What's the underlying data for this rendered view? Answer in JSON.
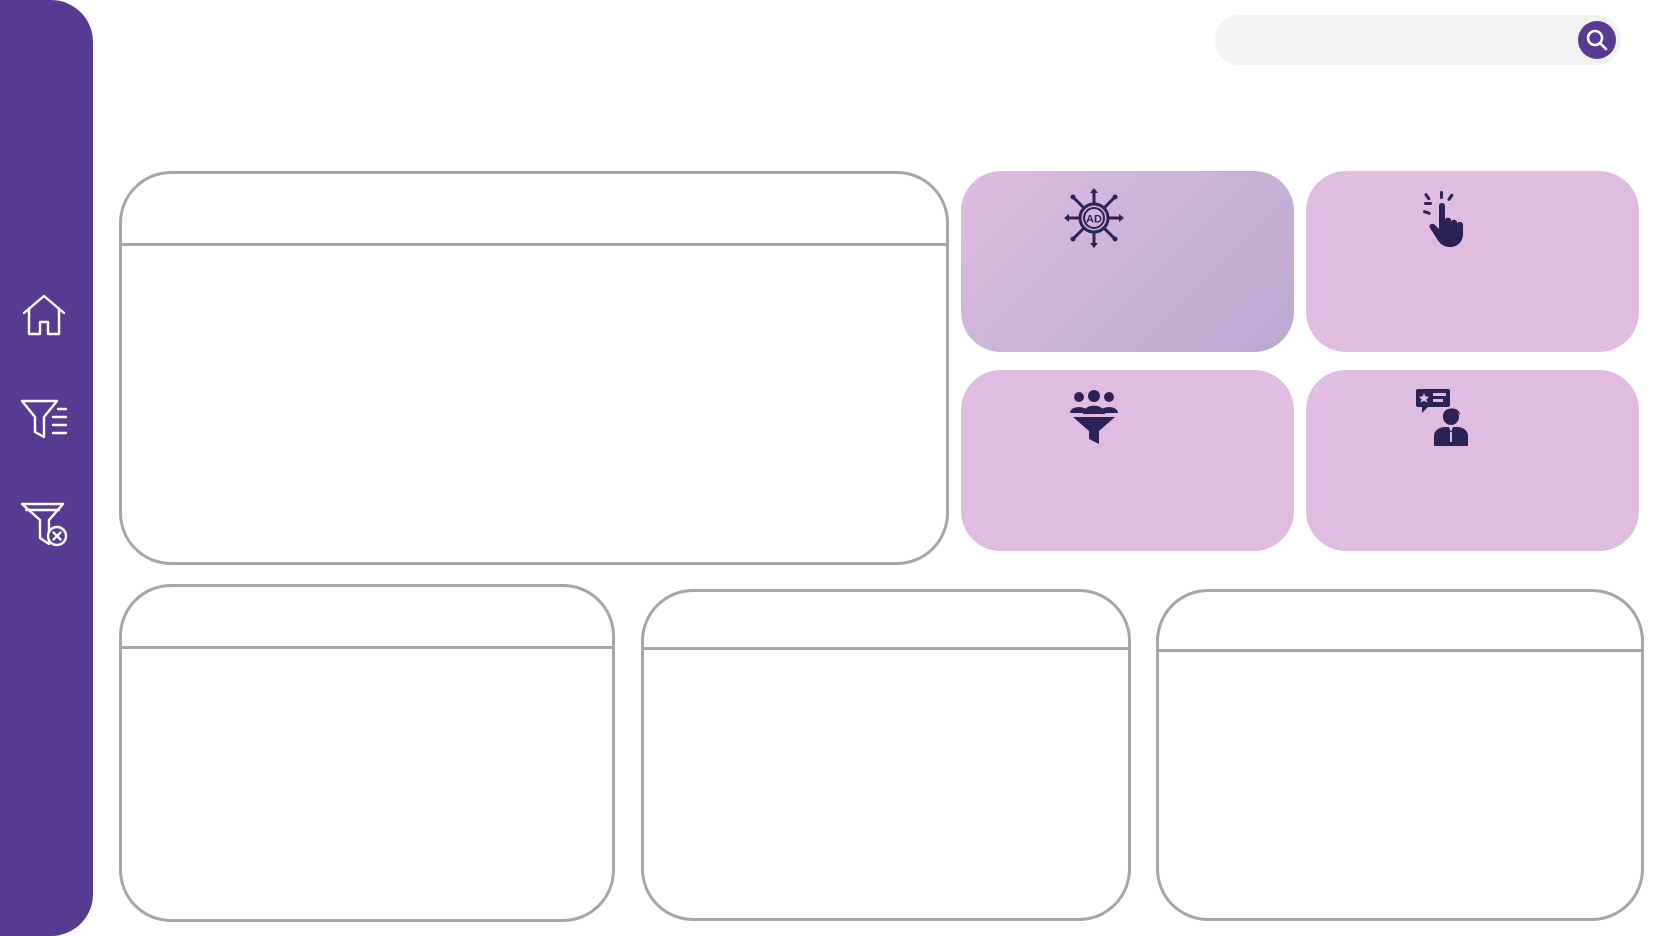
{
  "colors": {
    "sidebar": "#573b92",
    "tile": "#e0bce0",
    "tile_active_end": "#bca8d2",
    "icon": "#2b2357",
    "panel_border": "#a6a6a6",
    "search_bg": "#f2f2f2"
  },
  "sidebar": {
    "items": [
      {
        "icon": "home-icon"
      },
      {
        "icon": "filter-list-icon"
      },
      {
        "icon": "clear-filter-icon"
      }
    ]
  },
  "search": {
    "value": "",
    "placeholder": "",
    "button_icon": "search-icon"
  },
  "panels": {
    "main": {
      "title": ""
    },
    "bottom_left": {
      "title": ""
    },
    "bottom_middle": {
      "title": ""
    },
    "bottom_right": {
      "title": ""
    }
  },
  "tiles": [
    {
      "icon": "ad-broadcast-icon",
      "label": "",
      "value": "",
      "active": true
    },
    {
      "icon": "click-hand-icon",
      "label": "",
      "value": "",
      "active": false
    },
    {
      "icon": "audience-funnel-icon",
      "label": "",
      "value": "",
      "active": false
    },
    {
      "icon": "customer-review-icon",
      "label": "",
      "value": "",
      "active": false
    }
  ]
}
